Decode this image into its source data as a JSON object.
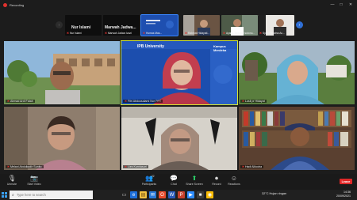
{
  "recording": {
    "label": "Recording"
  },
  "window": {
    "minimize": "—",
    "maximize": "□",
    "close": "✕"
  },
  "strip": {
    "big_names": [
      "Nur Islami",
      "Marwah Jadwa..."
    ],
    "thumbs": [
      {
        "name": "Nur Islami"
      },
      {
        "name": "Marwah Jadwa Izazi"
      },
      {
        "name": "Humas Mas..."
      },
      {
        "name": "Rahmat Hidayati..."
      },
      {
        "name": "Ayang-Tadodlei sutono..."
      },
      {
        "name": "Syah Priyatna Ac..."
      }
    ],
    "arrow_left": "‹",
    "arrow_right": "›"
  },
  "tiles": [
    {
      "name": "Ahmad Ardi Fatah"
    },
    {
      "name": "Fitri Abdussalami Nor PPT"
    },
    {
      "name": "Lusli pr Hidayat"
    },
    {
      "name": "Melani Abdulkadir Sunito"
    },
    {
      "name": "Lies Kurniasari"
    },
    {
      "name": "Hadi Alikodra"
    }
  ],
  "banner": {
    "brand": "IPB University",
    "motto": "Kampus Merdeka"
  },
  "toolbar": {
    "unmute": "Unmute",
    "start_video": "Start Video",
    "participants": "Participants",
    "participants_count": "22",
    "chat": "Chat",
    "share_screen": "Share Screen",
    "record": "Record",
    "reactions": "Reactions",
    "leave": "Leave"
  },
  "taskbar": {
    "search_placeholder": "Type here to search",
    "weather": "32°C Hujan ringan",
    "time": "14:36",
    "date": "20/09/2021"
  }
}
